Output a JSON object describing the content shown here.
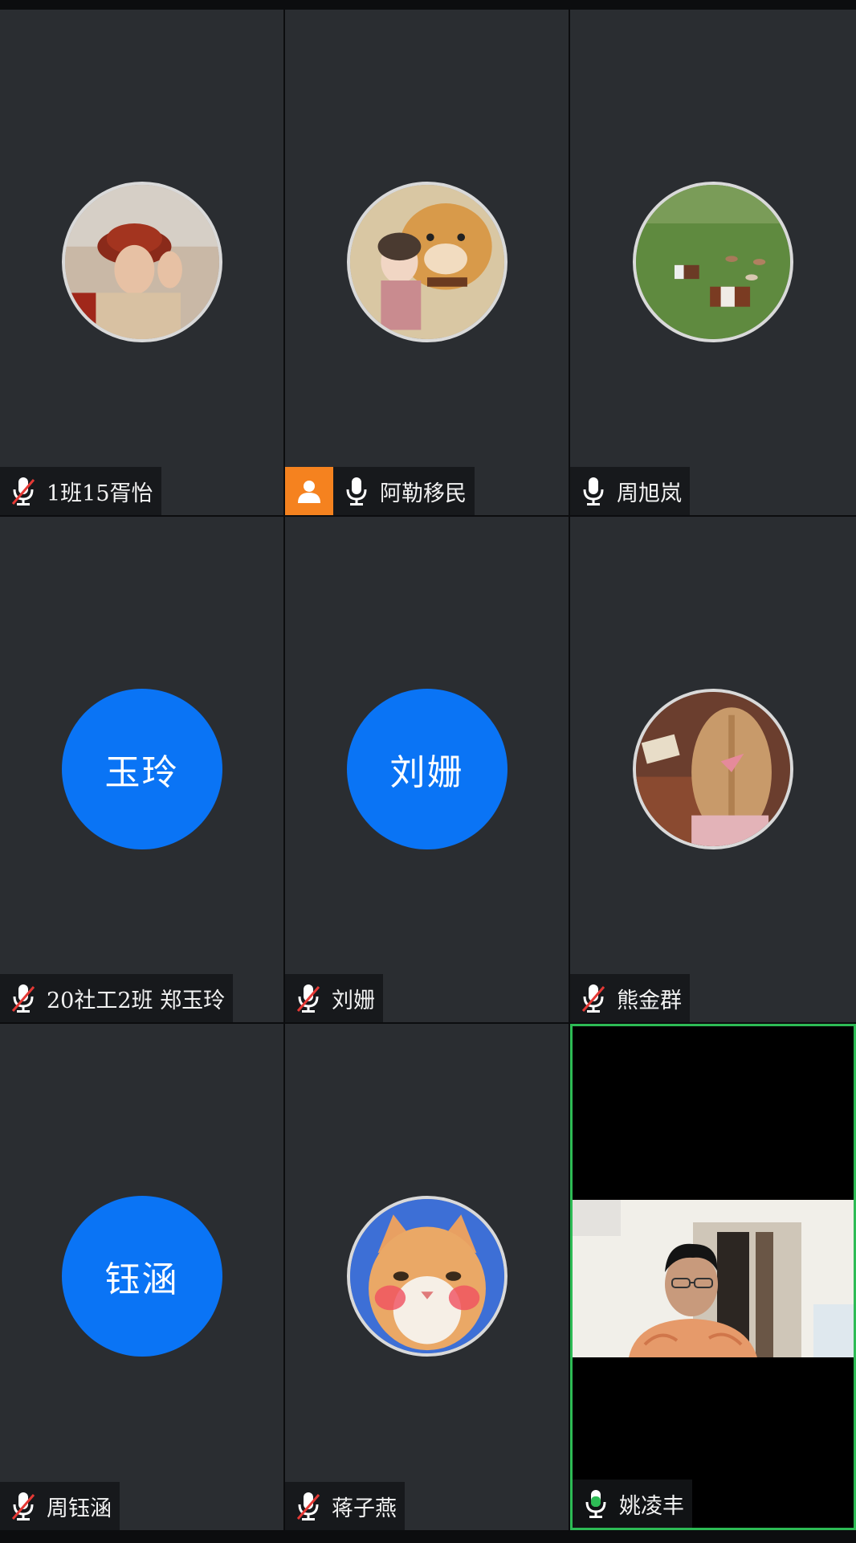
{
  "participants": [
    {
      "name": "1班15胥怡",
      "muted": true,
      "avatar": "photo-woman-red-hat"
    },
    {
      "name": "阿勒移民",
      "muted": false,
      "host": true,
      "avatar": "photo-girl-and-dog"
    },
    {
      "name": "周旭岚",
      "muted": false,
      "avatar": "photo-cows-grassland"
    },
    {
      "name": "20社工2班 郑玉玲",
      "muted": true,
      "avatar_text": "玉玲"
    },
    {
      "name": "刘姗",
      "muted": true,
      "avatar_text": "刘姗"
    },
    {
      "name": "熊金群",
      "muted": true,
      "avatar": "photo-girl-braids"
    },
    {
      "name": "周钰涵",
      "muted": true,
      "avatar_text": "钰涵"
    },
    {
      "name": "蒋子燕",
      "muted": true,
      "avatar": "photo-orange-cat"
    },
    {
      "name": "姚凌丰",
      "muted": false,
      "speaking": true,
      "video": "live-camera-feed"
    }
  ],
  "colors": {
    "tile_bg": "#2a2d31",
    "text_avatar_bg": "#0a74f5",
    "host_badge": "#f5821f",
    "active_border": "#2dbb55",
    "mic_muted_slash": "#e53935"
  }
}
